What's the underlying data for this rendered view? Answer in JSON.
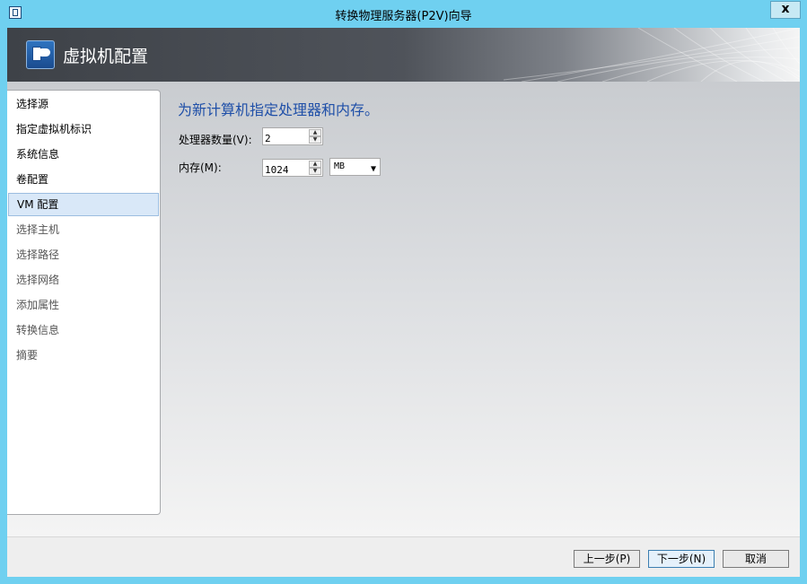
{
  "window": {
    "title": "转换物理服务器(P2V)向导",
    "close_label": "x"
  },
  "header": {
    "title": "虚拟机配置",
    "icon": "server-cloud-icon"
  },
  "nav": {
    "items": [
      {
        "label": "选择源",
        "state": "done"
      },
      {
        "label": "指定虚拟机标识",
        "state": "done"
      },
      {
        "label": "系统信息",
        "state": "done"
      },
      {
        "label": "卷配置",
        "state": "done"
      },
      {
        "label": "VM 配置",
        "state": "active"
      },
      {
        "label": "选择主机",
        "state": "pending"
      },
      {
        "label": "选择路径",
        "state": "pending"
      },
      {
        "label": "选择网络",
        "state": "pending"
      },
      {
        "label": "添加属性",
        "state": "pending"
      },
      {
        "label": "转换信息",
        "state": "pending"
      },
      {
        "label": "摘要",
        "state": "pending"
      }
    ]
  },
  "main": {
    "heading": "为新计算机指定处理器和内存。",
    "processor": {
      "label": "处理器数量(V):",
      "value": "2"
    },
    "memory": {
      "label": "内存(M):",
      "value": "1024",
      "unit": "MB"
    }
  },
  "footer": {
    "prev_label": "上一步(P)",
    "next_label": "下一步(N)",
    "cancel_label": "取消"
  }
}
